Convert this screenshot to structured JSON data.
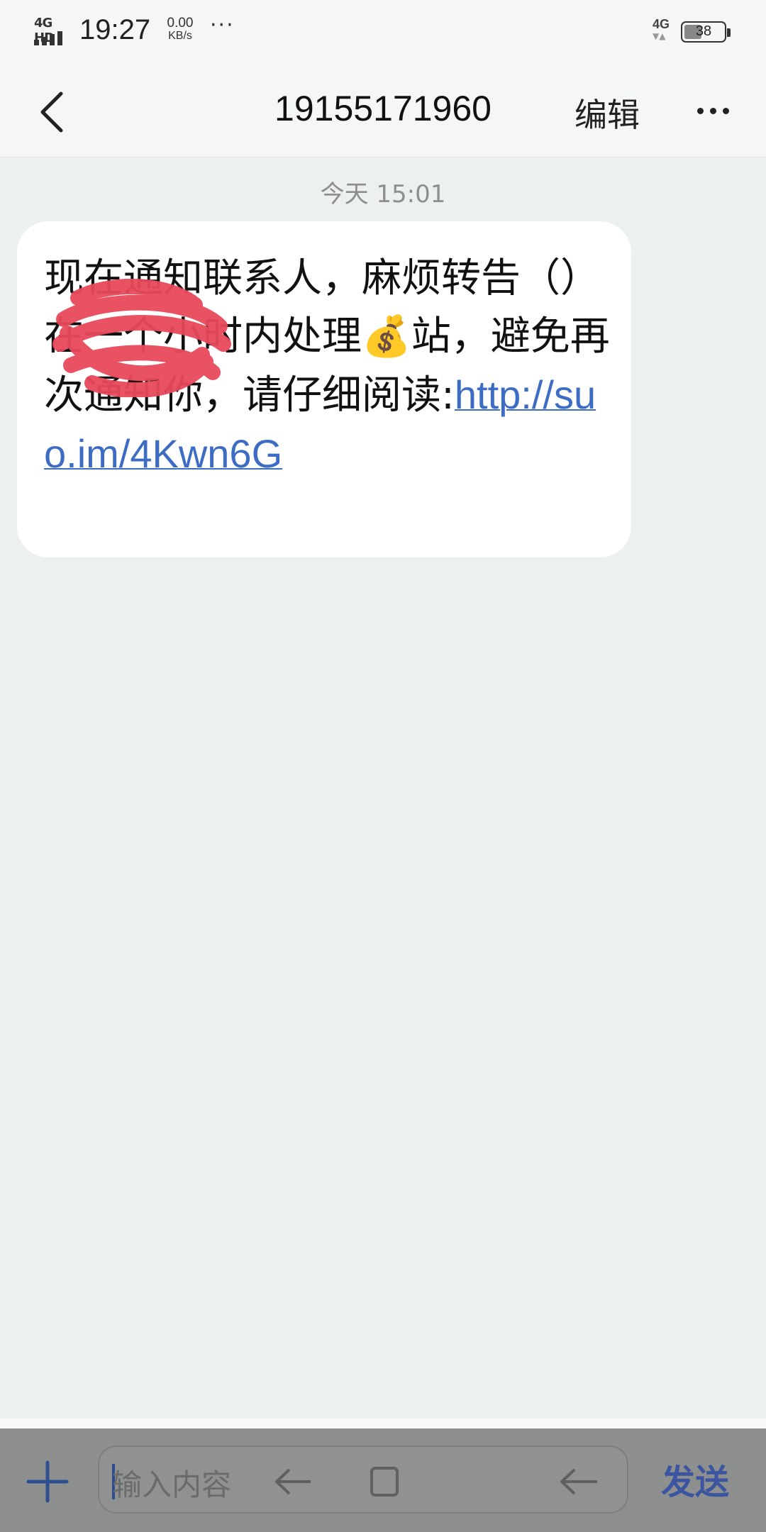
{
  "status_bar": {
    "signal_label": "4G HD",
    "time": "19:27",
    "net_speed_value": "0.00",
    "net_speed_unit": "KB/s",
    "overflow_dots": "···",
    "network_type": "4G",
    "network_arrows": "▼▲",
    "battery_level": "38"
  },
  "header": {
    "contact_number": "19155171960",
    "edit_label": "编辑"
  },
  "conversation": {
    "timestamp": "今天 15:01",
    "message_text_before_link": "现在通知联系人，麻烦转告（）在一个小时内处理💰站，避免再次通知你，请仔细阅读:",
    "message_link": "http://suo.im/4Kwn6G"
  },
  "composer": {
    "placeholder": "输入内容",
    "send_label": "发送"
  },
  "colors": {
    "link": "#3d6cc4",
    "send": "#3b55a0",
    "redaction": "#e8495a"
  }
}
